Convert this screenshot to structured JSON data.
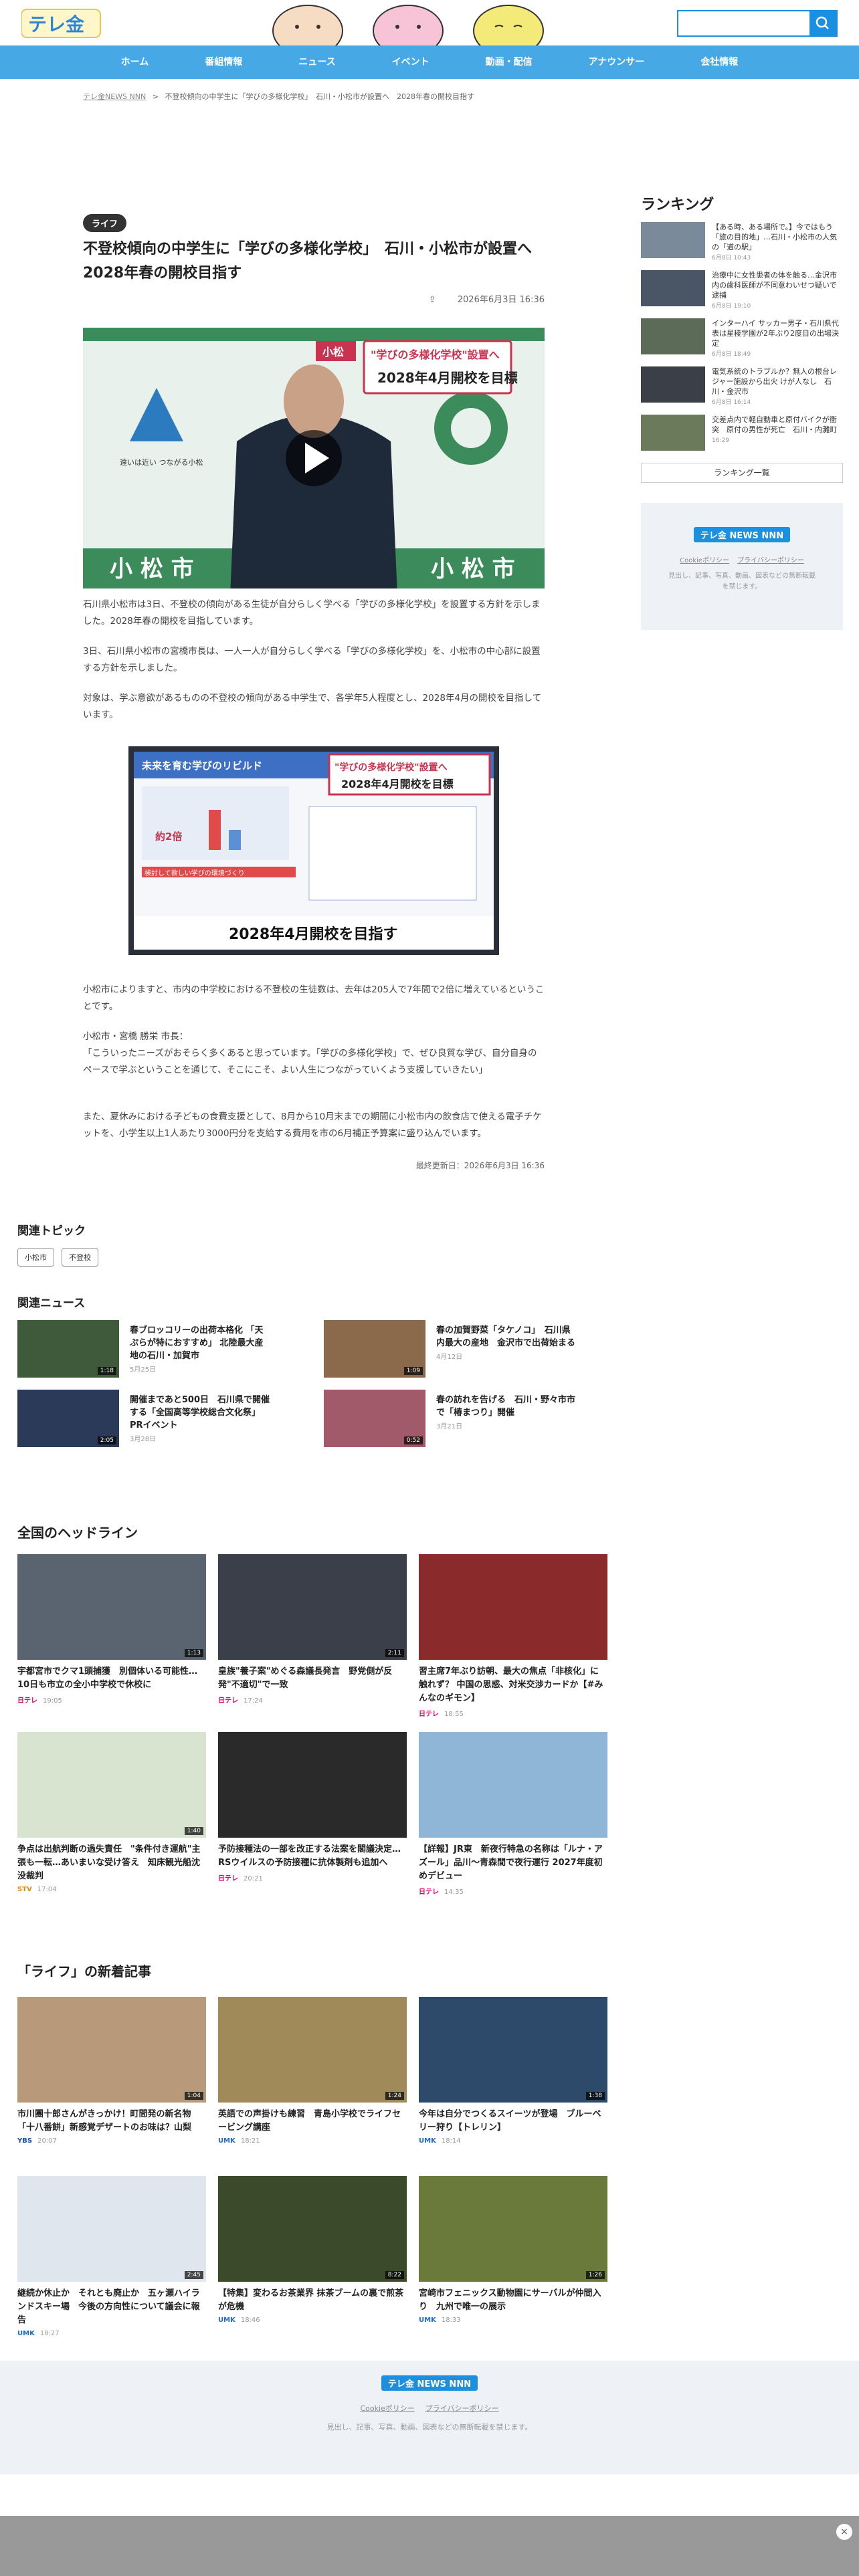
{
  "header": {
    "logo": "テレ金",
    "search_placeholder": ""
  },
  "nav": [
    "ホーム",
    "番組情報",
    "ニュース",
    "イベント",
    "動画・配信",
    "アナウンサー",
    "会社情報"
  ],
  "breadcrumb": {
    "home": "テレ金NEWS NNN",
    "sep": ">",
    "current": "不登校傾向の中学生に「学びの多様化学校」　石川・小松市が設置へ　2028年春の開校目指す"
  },
  "article": {
    "tag": "ライフ",
    "title": "不登校傾向の中学生に「学びの多様化学校」　石川・小松市が設置へ　2028年春の開校目指す",
    "date": "2026年6月3日 16:36",
    "video": {
      "banner1": "小松",
      "banner2": "\"学びの多様化学校\"設置へ",
      "banner3": "2028年4月開校を目標",
      "caption_left": "遠いは近い つながる小松",
      "bottom_text": "小 松 市",
      "bottom_text2": "小 松 市"
    },
    "p1": "石川県小松市は3日、不登校の傾向がある生徒が自分らしく学べる「学びの多様化学校」を設置する方針を示しました。2028年春の開校を目指しています。",
    "p2": "3日、石川県小松市の宮橋市長は、一人一人が自分らしく学べる「学びの多様化学校」を、小松市の中心部に設置する方針を示しました。",
    "p3": "対象は、学ぶ意欲があるものの不登校の傾向がある中学生で、各学年5人程度とし、2028年4月の開校を目指しています。",
    "image": {
      "corner": "未来を育む学びのリビルド",
      "banner": "\"学びの多様化学校\"設置へ",
      "sub": "2028年4月開校を目標",
      "bottom": "2028年4月開校を目指す",
      "small": "約2倍",
      "note": "検討して欲しい学びの環境づくり"
    },
    "p4": "小松市によりますと、市内の中学校における不登校の生徒数は、去年は205人で7年間で2倍に増えているということです。",
    "p5a": "小松市・宮橋 勝栄 市長：",
    "p5b": "「こういったニーズがおそらく多くあると思っています。「学びの多様化学校」で、ぜひ良質な学び、自分自身のペースで学ぶということを通じて、そこにこそ、よい人生につながっていくよう支援していきたい」",
    "p6": "また、夏休みにおける子どもの食費支援として、8月から10月末までの期間に小松市内の飲食店で使える電子チケットを、小学生以上1人あたり3000円分を支給する費用を市の6月補正予算案に盛り込んでいます。",
    "updated": "最終更新日：2026年6月3日 16:36"
  },
  "sidebar": {
    "title": "ランキング",
    "items": [
      {
        "text": "【ある時、ある場所で。】今ではもう「旅の目的地」…石川・小松市の人気の「道の駅」",
        "date": "6月8日 10:43"
      },
      {
        "text": "治療中に女性患者の体を触る…金沢市内の歯科医師が不同意わいせつ疑いで逮捕",
        "date": "6月8日 19:10"
      },
      {
        "text": "インターハイ サッカー男子・石川県代表は星稜学園が2年ぶり2度目の出場決定",
        "date": "6月8日 18:49"
      },
      {
        "text": "電気系統のトラブルか？無人の根台レジャー施設から出火 けが人なし　石川・金沢市",
        "date": "6月8日 16:14"
      },
      {
        "text": "交差点内で軽自動車と原付バイクが衝突　原付の男性が死亡　石川・内灘町",
        "date": "16:29"
      }
    ],
    "more": "ランキング一覧",
    "box_badge": "テレ金 NEWS NNN",
    "box_links": [
      "Cookieポリシー",
      "プライバシーポリシー"
    ],
    "box_note": "見出し、記事、写真、動画、図表などの無断転載を禁じます。"
  },
  "topics": {
    "title": "関連トピック",
    "tags": [
      "小松市",
      "不登校"
    ]
  },
  "related": {
    "title": "関連ニュース",
    "items": [
      {
        "text": "春ブロッコリーの出荷本格化 「天ぷらが特におすすめ」 北陸最大産地の石川・加賀市",
        "date": "5月25日",
        "dur": "1:18"
      },
      {
        "text": "春の加賀野菜「タケノコ」　石川県内最大の産地　金沢市で出荷始まる",
        "date": "4月12日",
        "dur": "1:09"
      },
      {
        "text": "開催まであと500日　石川県で開催する「全国高等学校総合文化祭」PRイベント",
        "date": "3月28日",
        "dur": "2:05"
      },
      {
        "text": "春の訪れを告げる　石川・野々市市で「椿まつり」開催",
        "date": "3月21日",
        "dur": "0:52"
      }
    ]
  },
  "headlines": {
    "title": "全国のヘッドライン",
    "items": [
      {
        "text": "宇都宮市でクマ1頭捕獲　別個体いる可能性…10日も市立の全小中学校で休校に",
        "src": "日テレ",
        "time": "19:05",
        "dur": "1:13"
      },
      {
        "text": "皇族\"養子案\"めぐる森議長発言　野党側が反発\"不適切\"で一致",
        "src": "日テレ",
        "time": "17:24",
        "dur": "2:11"
      },
      {
        "text": "習主席7年ぶり訪朝、最大の焦点「非核化」に触れず？ 中国の思惑、対米交渉カードか【#みんなのギモン】",
        "src": "日テレ",
        "time": "18:55",
        "dur": ""
      },
      {
        "text": "争点は出航判断の過失責任　\"条件付き運航\"主張も一転…あいまいな受け答え　知床観光船沈没裁判",
        "src": "STV",
        "time": "17:04",
        "dur": "1:40"
      },
      {
        "text": "予防接種法の一部を改正する法案を閣議決定…RSウイルスの予防接種に抗体製剤も追加へ",
        "src": "日テレ",
        "time": "20:21",
        "dur": ""
      },
      {
        "text": "【詳報】JR東　新夜行特急の名称は「ルナ・アズール」品川～青森間で夜行運行 2027年度初めデビュー",
        "src": "日テレ",
        "time": "14:35",
        "dur": ""
      }
    ]
  },
  "life": {
    "title": "「ライフ」の新着記事",
    "items": [
      {
        "text": "市川團十郎さんがきっかけ！町間発の新名物「十八番餅」新感覚デザートのお味は？山梨",
        "src": "YBS",
        "time": "20:07",
        "dur": "1:04"
      },
      {
        "text": "英語での声掛けも練習　青島小学校でライフセービング講座",
        "src": "UMK",
        "time": "18:21",
        "dur": "1:24"
      },
      {
        "text": "今年は自分でつくるスイーツが登場　ブルーベリー狩り【トレリン】",
        "src": "UMK",
        "time": "18:14",
        "dur": "1:38"
      },
      {
        "text": "継続か休止か　それとも廃止か　五ヶ瀬ハイランドスキー場　今後の方向性について議会に報告",
        "src": "UMK",
        "time": "18:27",
        "dur": "2:45"
      },
      {
        "text": "【特集】変わるお茶業界 抹茶ブームの裏で煎茶が危機",
        "src": "UMK",
        "time": "18:46",
        "dur": "8:22"
      },
      {
        "text": "宮崎市フェニックス動物園にサーバルが仲間入り　九州で唯一の展示",
        "src": "UMK",
        "time": "18:33",
        "dur": "1:26"
      }
    ]
  },
  "footer": {
    "badge": "テレ金 NEWS NNN",
    "links": [
      "Cookieポリシー",
      "プライバシーポリシー"
    ],
    "note": "見出し、記事、写真、動画、図表などの無断転載を禁じます。"
  },
  "ad": {
    "close": "×"
  }
}
